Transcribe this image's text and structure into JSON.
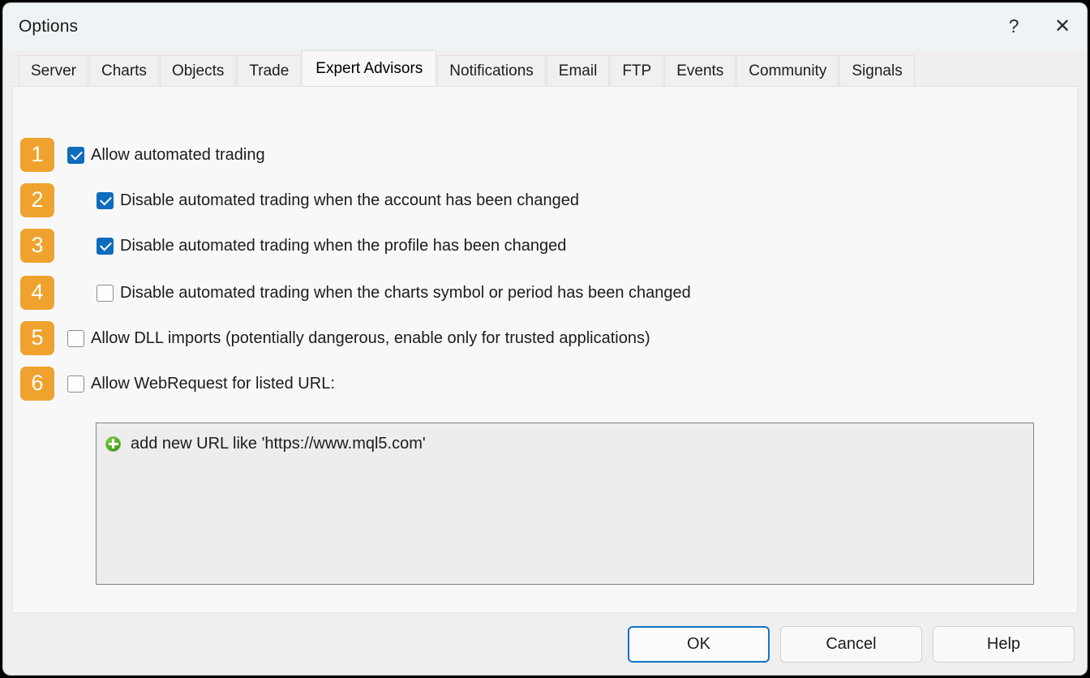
{
  "window": {
    "title": "Options",
    "help_icon": "question-mark-icon",
    "help_glyph": "?",
    "close_icon": "close-icon",
    "close_glyph": "✕"
  },
  "tabs": [
    {
      "label": "Server",
      "active": false
    },
    {
      "label": "Charts",
      "active": false
    },
    {
      "label": "Objects",
      "active": false
    },
    {
      "label": "Trade",
      "active": false
    },
    {
      "label": "Expert Advisors",
      "active": true
    },
    {
      "label": "Notifications",
      "active": false
    },
    {
      "label": "Email",
      "active": false
    },
    {
      "label": "FTP",
      "active": false
    },
    {
      "label": "Events",
      "active": false
    },
    {
      "label": "Community",
      "active": false
    },
    {
      "label": "Signals",
      "active": false
    }
  ],
  "options": [
    {
      "badge": "1",
      "label": "Allow automated trading",
      "checked": true,
      "indent": 0
    },
    {
      "badge": "2",
      "label": "Disable automated trading when the account has been changed",
      "checked": true,
      "indent": 1
    },
    {
      "badge": "3",
      "label": "Disable automated trading when the profile has been changed",
      "checked": true,
      "indent": 1
    },
    {
      "badge": "4",
      "label": "Disable automated trading when the charts symbol or period has been changed",
      "checked": false,
      "indent": 1
    },
    {
      "badge": "5",
      "label": "Allow DLL imports (potentially dangerous, enable only for trusted applications)",
      "checked": false,
      "indent": 0
    },
    {
      "badge": "6",
      "label": "Allow WebRequest for listed URL:",
      "checked": false,
      "indent": 0
    }
  ],
  "url_list": {
    "add_icon": "green-plus-icon",
    "add_row_text": "add new URL like 'https://www.mql5.com'"
  },
  "footer": {
    "ok_label": "OK",
    "cancel_label": "Cancel",
    "help_label": "Help"
  },
  "colors": {
    "badge_orange": "#efa22d",
    "checkbox_blue": "#0f6cbd",
    "focus_blue": "#1473c8",
    "plus_green": "#4aa21c",
    "titlebar": "#eef3f6",
    "panel": "#f8f8f8",
    "chrome": "#efefef"
  }
}
